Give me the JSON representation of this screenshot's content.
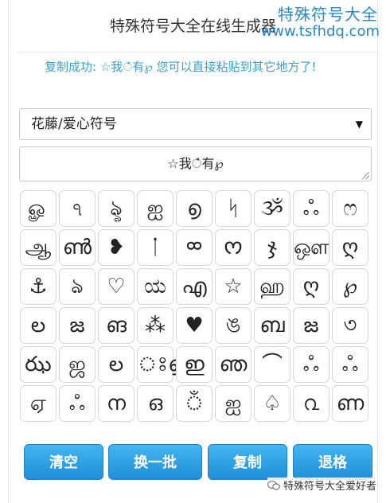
{
  "header": {
    "title": "特殊符号大全在线生成器",
    "site_name": "特殊符号大全",
    "site_url": "www.tsfhdq.com"
  },
  "status": {
    "message": "复制成功: ☆我ഀ有℘ 您可以直接粘贴到其它地方了!"
  },
  "category": {
    "selected": "花藤/爱心符号",
    "caret": "▼"
  },
  "result": {
    "value": "☆我ഀ有℘"
  },
  "symbols": [
    [
      "ௐ",
      "ঀ",
      "ৡ",
      "ஐ",
      "൭",
      "ᛋ",
      "ૐ",
      "ஃ",
      "ෆ"
    ],
    [
      "ஆ",
      "ൺ",
      "❥",
      "ᛙ",
      "ᢁ",
      "ᰔ",
      "ჯ",
      "ஔ",
      "ღ"
    ],
    [
      "⚓",
      "ঌ",
      "♡",
      "ಯ",
      "എ",
      "☆",
      "ஹ",
      "ღ",
      "℘"
    ],
    [
      "ల",
      "జ",
      "ങ",
      "⁂",
      "♥",
      "ঙ",
      "ബ",
      "జ",
      "৩"
    ],
    [
      "ఝ",
      "ஜ",
      "ల",
      "ঃ൭",
      "ഇ",
      "ഞ",
      "⌒",
      "ஃ",
      "ஃ"
    ],
    [
      "ஏ",
      "ஃ",
      "ന",
      "ഒ",
      "ঁ",
      "ஐ",
      "♤",
      "൨",
      "ണ"
    ]
  ],
  "buttons": {
    "clear": "清空",
    "next_batch": "换一批",
    "copy": "复制",
    "backspace": "退格"
  },
  "footer": {
    "badge_text": "特殊符号大全爱好者"
  },
  "colors": {
    "accent": "#2a88c8",
    "button": "#1f8fd8",
    "status": "#3aa0c6"
  }
}
